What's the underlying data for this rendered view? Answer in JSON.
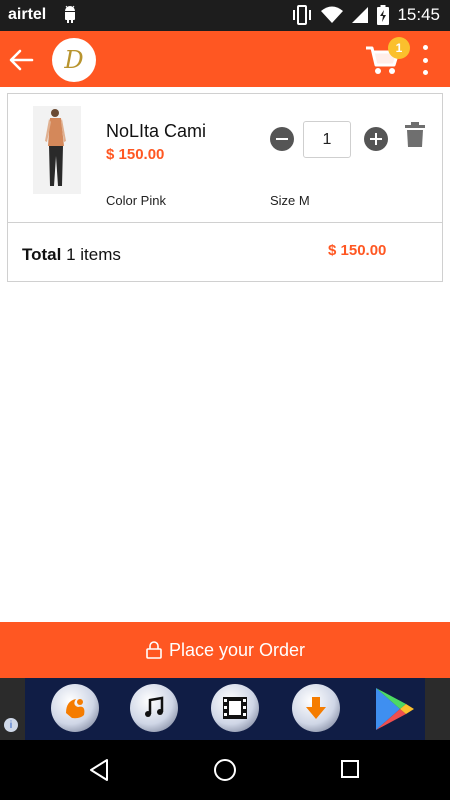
{
  "status_bar": {
    "carrier": "airtel",
    "time": "15:45",
    "icons": [
      "android-icon",
      "vibrate-icon",
      "wifi-icon",
      "signal-icon",
      "battery-icon"
    ]
  },
  "app_bar": {
    "logo_text": "D",
    "cart_count": "1",
    "accent_color": "#ff5722"
  },
  "cart": {
    "items": [
      {
        "name": "NoLIta Cami",
        "price": "$ 150.00",
        "quantity": "1",
        "color": "Color Pink",
        "size": "Size M"
      }
    ],
    "total_label": "Total",
    "total_count": "1 items",
    "total_price": "$ 150.00"
  },
  "order_button": {
    "label": "Place your Order"
  },
  "ad_banner": {
    "info_label": "i",
    "icons": [
      "uc-browser-icon",
      "music-icon",
      "video-icon",
      "download-icon",
      "play-store-icon"
    ]
  }
}
